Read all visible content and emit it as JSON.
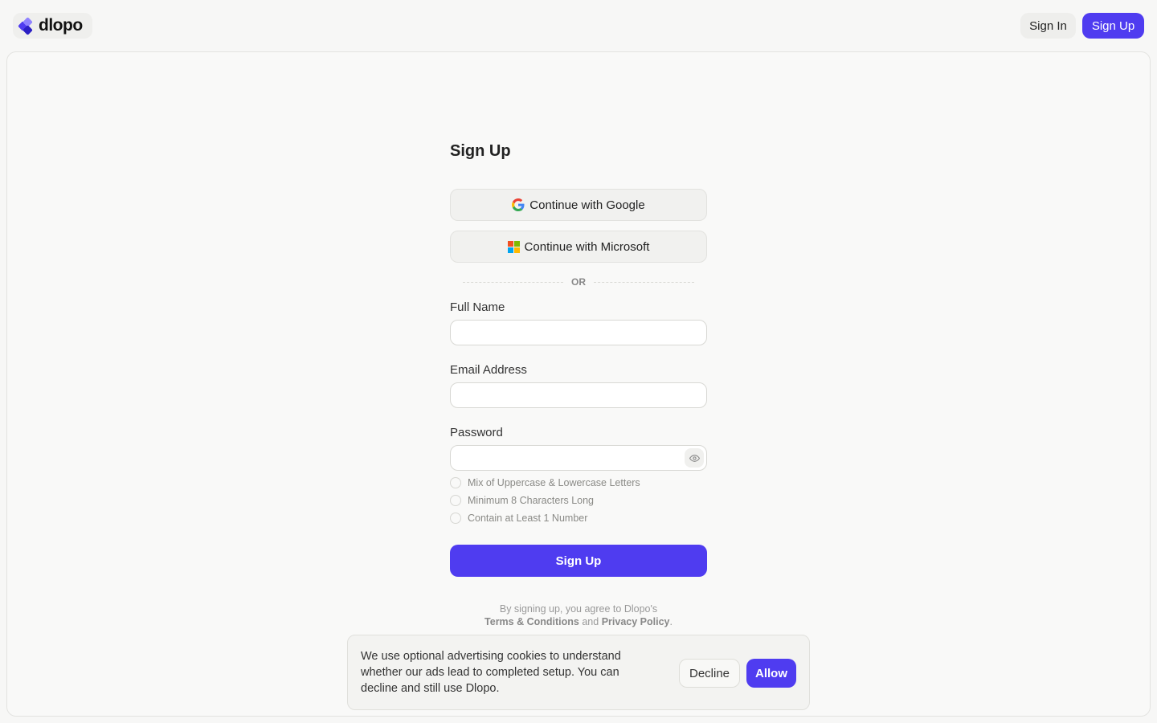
{
  "header": {
    "logo_text": "dlopo",
    "signin_label": "Sign In",
    "signup_label": "Sign Up"
  },
  "form": {
    "title": "Sign Up",
    "google_label": "Continue with Google",
    "microsoft_label": "Continue with Microsoft",
    "or_text": "OR",
    "fullname_label": "Full Name",
    "fullname_value": "",
    "email_label": "Email Address",
    "email_value": "",
    "password_label": "Password",
    "password_value": "",
    "rules": [
      "Mix of Uppercase & Lowercase Letters",
      "Minimum 8 Characters Long",
      "Contain at Least 1 Number"
    ],
    "submit_label": "Sign Up",
    "legal_prefix": "By signing up, you agree to Dlopo's",
    "terms_label": "Terms & Conditions",
    "legal_and": "and",
    "privacy_label": "Privacy Policy",
    "legal_suffix": "."
  },
  "cookie": {
    "message": "We use optional advertising cookies to understand whether our ads lead to completed setup. You can decline and still use Dlopo.",
    "decline_label": "Decline",
    "allow_label": "Allow"
  },
  "colors": {
    "accent": "#4f3cf0",
    "background": "#f7f7f6"
  },
  "icons": [
    "dlopo-logo-icon",
    "google-icon",
    "microsoft-icon",
    "eye-icon"
  ]
}
